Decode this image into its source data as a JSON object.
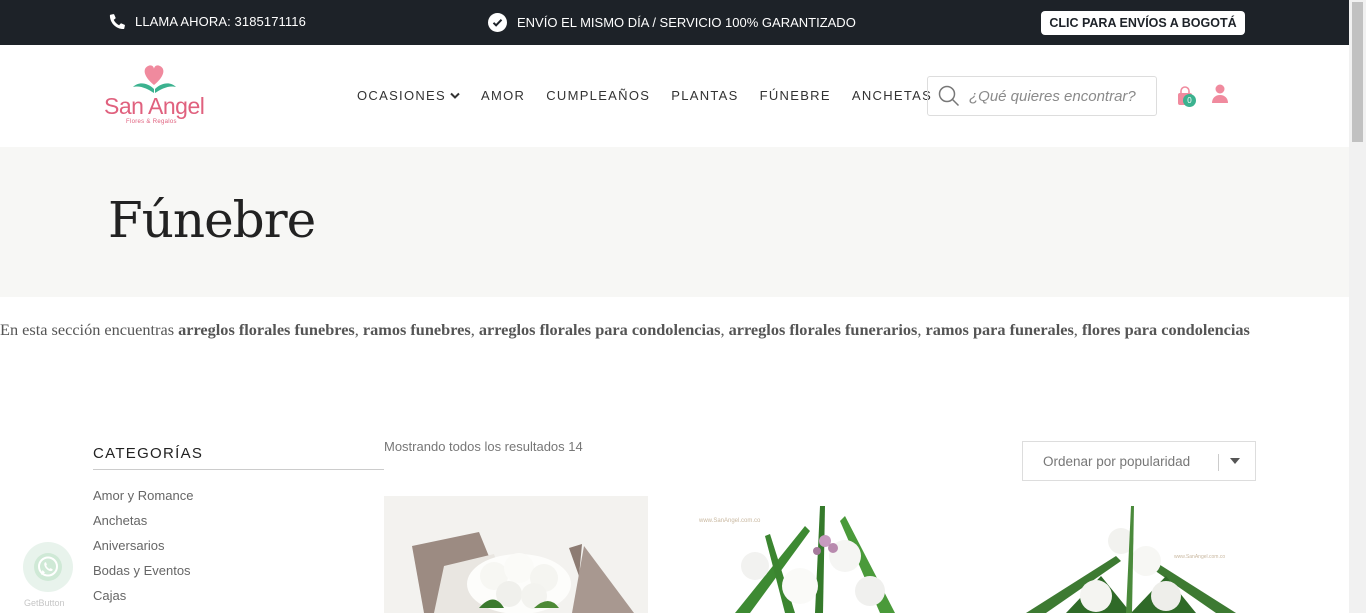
{
  "topbar": {
    "phone_text": "LLAMA AHORA: 3185171116",
    "promo_text": "ENVÍO EL MISMO DÍA / SERVICIO 100% GARANTIZADO",
    "cta_label": "CLIC PARA ENVÍOS A BOGOTÁ",
    "background": "#1d2228"
  },
  "logo": {
    "brand": "San Angel",
    "tagline": "Flores & Regalos",
    "color": "#e0617e"
  },
  "nav": {
    "items": [
      "OCASIONES",
      "AMOR",
      "CUMPLEAÑOS",
      "PLANTAS",
      "FÚNEBRE",
      "ANCHETAS"
    ]
  },
  "search": {
    "placeholder": "¿Qué quieres encontrar?"
  },
  "cart": {
    "count": "0",
    "badge_color": "#3bb28f"
  },
  "hero": {
    "title": "Fúnebre"
  },
  "intro": {
    "prefix": "En esta sección encuentras ",
    "links": [
      "arreglos florales funebres",
      "ramos funebres",
      "arreglos florales para condolencias",
      "arreglos florales funerarios",
      "ramos para funerales",
      "flores para condolencias"
    ],
    "separator": ", "
  },
  "sidebar": {
    "title": "CATEGORÍAS",
    "items": [
      "Amor y Romance",
      "Anchetas",
      "Aniversarios",
      "Bodas y Eventos",
      "Cajas"
    ]
  },
  "shop": {
    "results_text": "Mostrando todos los resultados 14",
    "sort_selected": "Ordenar por popularidad",
    "watermark": "www.SanAngel.com.co"
  },
  "widget": {
    "label": "GetButton"
  }
}
